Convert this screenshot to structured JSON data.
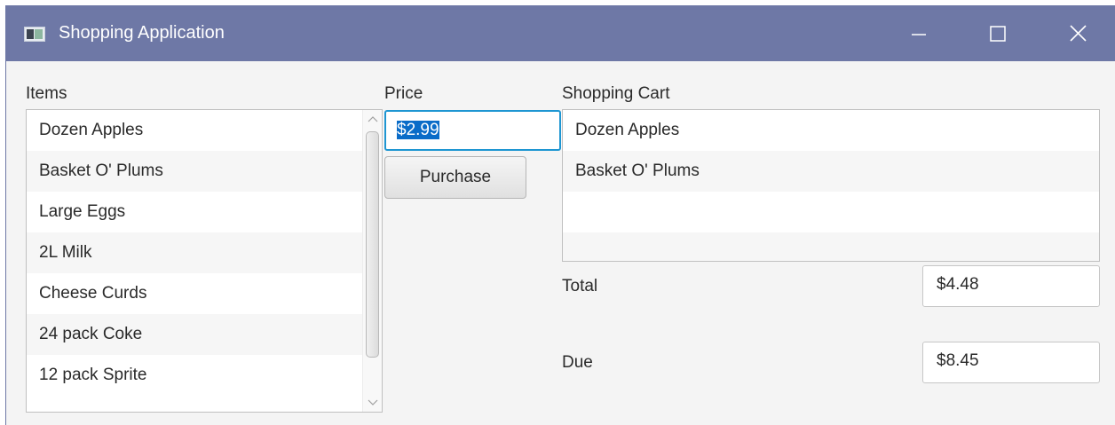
{
  "window": {
    "title": "Shopping Application",
    "icons": [
      "app-icon",
      "minimize-icon",
      "maximize-icon",
      "close-icon"
    ]
  },
  "items": {
    "label": "Items",
    "list": [
      "Dozen Apples",
      "Basket O' Plums",
      "Large Eggs",
      "2L Milk",
      "Cheese Curds",
      "24 pack Coke",
      "12 pack Sprite"
    ]
  },
  "price": {
    "label": "Price",
    "value": "$2.99"
  },
  "purchase_button": "Purchase",
  "cart": {
    "label": "Shopping Cart",
    "list": [
      "Dozen Apples",
      "Basket O' Plums"
    ]
  },
  "total": {
    "label": "Total",
    "value": "$4.48"
  },
  "due": {
    "label": "Due",
    "value": "$8.45"
  },
  "colors": {
    "titlebar": "#6e78a6",
    "focus": "#1e96d2",
    "selection": "#0a6cc8"
  }
}
